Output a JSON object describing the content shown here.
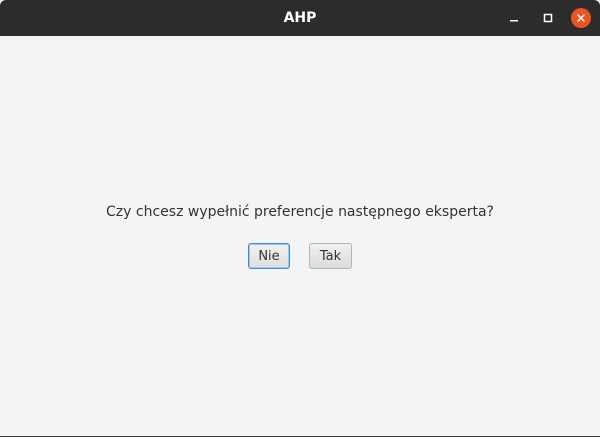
{
  "window": {
    "title": "AHP"
  },
  "dialog": {
    "question": "Czy chcesz wypełnić preferencje następnego eksperta?",
    "no_label": "Nie",
    "yes_label": "Tak",
    "focused_button": "Nie"
  },
  "icons": {
    "minimize": "minimize-icon",
    "maximize": "maximize-icon",
    "close": "close-icon"
  },
  "colors": {
    "titlebar": "#2c2c2c",
    "close_accent": "#e95420",
    "background": "#f4f4f4",
    "focus_border": "#3b8fd0"
  }
}
